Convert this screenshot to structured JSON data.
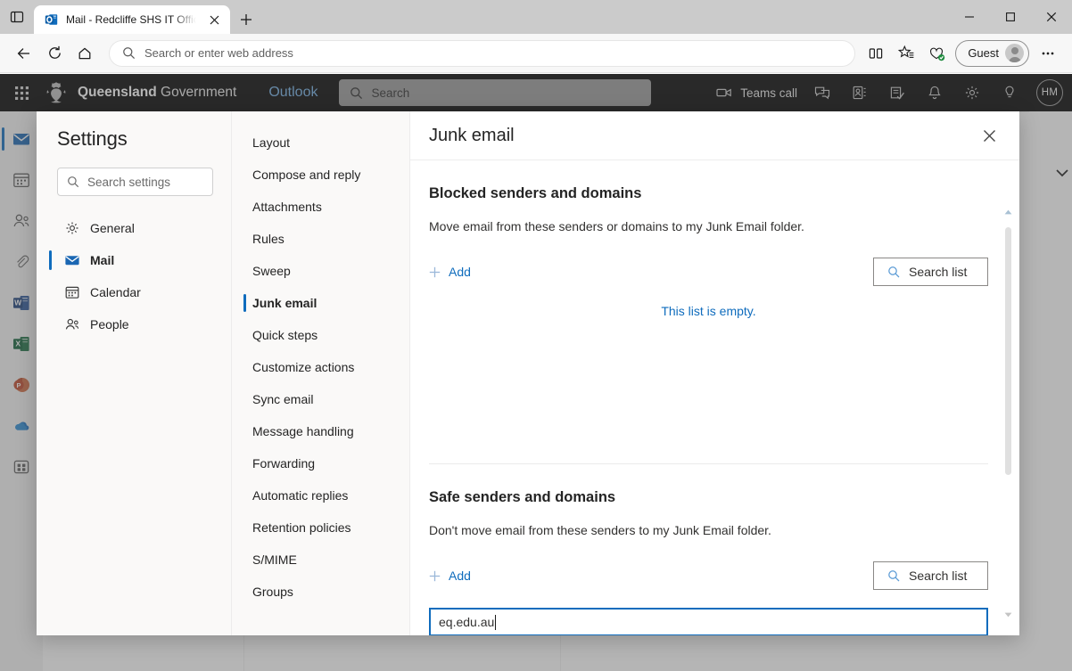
{
  "browser": {
    "tab": {
      "title": "Mail - Redcliffe SHS IT Office - O",
      "favicon_name": "outlook-favicon"
    },
    "new_tab_label": "+",
    "omnibox_placeholder": "Search or enter web address",
    "profile_label": "Guest",
    "window_controls": {
      "minimize": "—",
      "maximize": "□",
      "close": "✕"
    }
  },
  "outlook_header": {
    "org_bold": "Queensland",
    "org_regular": " Government",
    "brand": "Outlook",
    "search_placeholder": "Search",
    "teams_call_label": "Teams call",
    "avatar_initials": "HM"
  },
  "app_rail": [
    {
      "name": "mail",
      "selected": true
    },
    {
      "name": "calendar",
      "selected": false
    },
    {
      "name": "people",
      "selected": false
    },
    {
      "name": "files",
      "selected": false
    },
    {
      "name": "word",
      "selected": false
    },
    {
      "name": "excel",
      "selected": false
    },
    {
      "name": "powerpoint",
      "selected": false
    },
    {
      "name": "onedrive",
      "selected": false
    },
    {
      "name": "apps",
      "selected": false
    }
  ],
  "settings": {
    "title": "Settings",
    "search_placeholder": "Search settings",
    "categories": [
      {
        "label": "General",
        "icon": "gear-icon",
        "selected": false
      },
      {
        "label": "Mail",
        "icon": "envelope-icon",
        "selected": true
      },
      {
        "label": "Calendar",
        "icon": "calendar-icon",
        "selected": false
      },
      {
        "label": "People",
        "icon": "people-icon",
        "selected": false
      }
    ],
    "nav_items": [
      {
        "label": "Layout",
        "selected": false
      },
      {
        "label": "Compose and reply",
        "selected": false
      },
      {
        "label": "Attachments",
        "selected": false
      },
      {
        "label": "Rules",
        "selected": false
      },
      {
        "label": "Sweep",
        "selected": false
      },
      {
        "label": "Junk email",
        "selected": true
      },
      {
        "label": "Quick steps",
        "selected": false
      },
      {
        "label": "Customize actions",
        "selected": false
      },
      {
        "label": "Sync email",
        "selected": false
      },
      {
        "label": "Message handling",
        "selected": false
      },
      {
        "label": "Forwarding",
        "selected": false
      },
      {
        "label": "Automatic replies",
        "selected": false
      },
      {
        "label": "Retention policies",
        "selected": false
      },
      {
        "label": "S/MIME",
        "selected": false
      },
      {
        "label": "Groups",
        "selected": false
      }
    ],
    "panel": {
      "heading": "Junk email",
      "close_label": "✕",
      "blocked": {
        "title": "Blocked senders and domains",
        "description": "Move email from these senders or domains to my Junk Email folder.",
        "add_label": "Add",
        "search_label": "Search list",
        "empty_message": "This list is empty."
      },
      "safe": {
        "title": "Safe senders and domains",
        "description": "Don't move email from these senders to my Junk Email folder.",
        "add_label": "Add",
        "search_label": "Search list",
        "input_value": "eq.edu.au"
      }
    }
  },
  "colors": {
    "accent": "#0f6cbd",
    "header_bg": "#000000",
    "brand_blue": "#71afe5",
    "panel_bg": "#faf9f8",
    "focus_border": "#0f6cbd"
  }
}
